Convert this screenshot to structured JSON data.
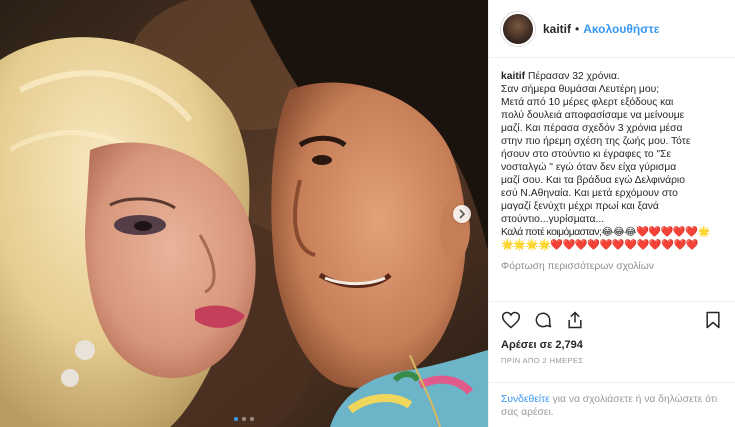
{
  "header": {
    "username": "kaitif",
    "separator": "•",
    "follow_label": "Ακολουθήστε"
  },
  "caption": {
    "username": "kaitif",
    "lines": [
      "Πέρασαν 32 χρόνια.",
      "Σαν σήμερα θυμάσαι Λευτέρη μου;",
      "Μετά από 10 μέρες φλερτ εξόδους και",
      "πολύ δουλειά αποφασίσαμε να μείνουμε",
      "μαζί. Και πέρασα σχεδόν 3 χρόνια μέσα",
      "στην πιο ήρεμη σχέση της ζωής μου. Τότε",
      "ήσουν στο στούντιο κι έγραφες το \"Σε",
      "νοσταλγώ \" εγώ όταν δεν είχα γύρισμα",
      "μαζί σου. Και τα βράδυα εγώ Δελφινάριο",
      "εσύ Ν.Αθηναία. Και μετά ερχόμουν στο",
      "μαγαζί ξενύχτι μέχρι πρωί και ξανά",
      "στούντιο...γυρίσματα..."
    ],
    "last_line": "Καλά ποτέ κοιμόμασταν;😂😂😂❤️❤️❤️❤️❤️🌟",
    "emoji_line": "🌟🌟🌟🌟❤️❤️❤️❤️❤️❤️❤️❤️❤️❤️❤️❤️"
  },
  "load_more_label": "Φόρτωση περισσότερων σχολίων",
  "likes_label": "Αρέσει σε 2,794",
  "timestamp": "ΠΡΙΝ ΑΠΟ 2 ΗΜΕΡΕΣ",
  "login": {
    "link_label": "Συνδεθείτε",
    "rest_text": " για να σχολιάσετε ή να δηλώσετε ότι σας αρέσει."
  },
  "carousel": {
    "slide_count": 3,
    "active_index": 0
  },
  "icons": {
    "like": "heart-icon",
    "comment": "comment-icon",
    "share": "share-icon",
    "save": "bookmark-icon",
    "next": "chevron-right-icon"
  },
  "colors": {
    "accent": "#3897f0",
    "text": "#262626",
    "muted": "#999999",
    "border": "#efefef"
  }
}
